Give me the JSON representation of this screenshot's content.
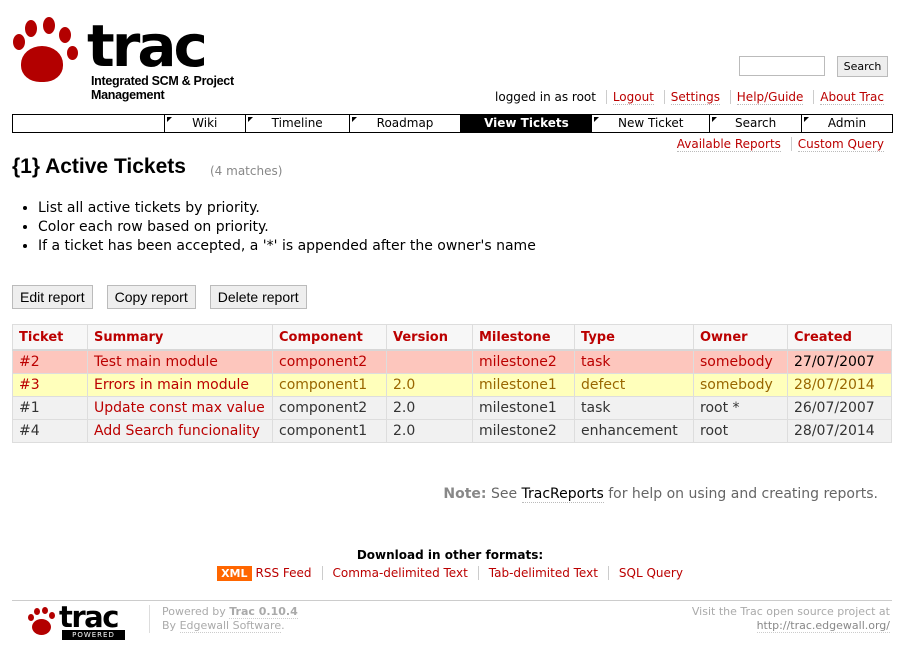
{
  "header": {
    "logo_word": "trac",
    "logo_tagline": "Integrated SCM & Project Management",
    "search_button": "Search"
  },
  "metanav": [
    "logged in as root",
    "Logout",
    "Settings",
    "Help/Guide",
    "About Trac"
  ],
  "mainnav": {
    "tabs": [
      "Wiki",
      "Timeline",
      "Roadmap",
      "View Tickets",
      "New Ticket",
      "Search",
      "Admin"
    ],
    "active": "View Tickets"
  },
  "ctxtnav": [
    "Available Reports",
    "Custom Query"
  ],
  "report": {
    "title": "{1} Active Tickets",
    "match_count": "(4 matches)",
    "description": [
      "List all active tickets by priority.",
      "Color each row based on priority.",
      "If a ticket has been accepted, a '*' is appended after the owner's name"
    ],
    "buttons": [
      "Edit report",
      "Copy report",
      "Delete report"
    ]
  },
  "table": {
    "columns": [
      "Ticket",
      "Summary",
      "Component",
      "Version",
      "Milestone",
      "Type",
      "Owner",
      "Created"
    ],
    "rows": [
      {
        "ticket": "#2",
        "summary": "Test main module",
        "component": "component2",
        "version": "",
        "milestone": "milestone2",
        "type": "task",
        "owner": "somebody",
        "created": "27/07/2007"
      },
      {
        "ticket": "#3",
        "summary": "Errors in main module",
        "component": "component1",
        "version": "2.0",
        "milestone": "milestone1",
        "type": "defect",
        "owner": "somebody",
        "created": "28/07/2014"
      },
      {
        "ticket": "#1",
        "summary": "Update const max value",
        "component": "component2",
        "version": "2.0",
        "milestone": "milestone1",
        "type": "task",
        "owner": "root *",
        "created": "26/07/2007"
      },
      {
        "ticket": "#4",
        "summary": "Add Search funcionality",
        "component": "component1",
        "version": "2.0",
        "milestone": "milestone2",
        "type": "enhancement",
        "owner": "root",
        "created": "28/07/2014"
      }
    ]
  },
  "note": {
    "label": "Note:",
    "prefix": "See",
    "link": "TracReports",
    "suffix": "for help on using and creating reports."
  },
  "altlinks": {
    "title": "Download in other formats:",
    "xml_badge": "XML",
    "formats": [
      "RSS Feed",
      "Comma-delimited Text",
      "Tab-delimited Text",
      "SQL Query"
    ]
  },
  "footer": {
    "logo_word": "trac",
    "powered_badge": "POWERED",
    "powered_by": "Powered by",
    "version": "Trac 0.10.4",
    "by": "By",
    "company": "Edgewall Software",
    "visit_text": "Visit the Trac open source project at",
    "url": "http://trac.edgewall.org/"
  },
  "colors": {
    "link": "#bb0000",
    "priority_high_row": "#fdc6bd",
    "priority_normal_row": "#ffffbb",
    "priority_low_row": "#f1f1f1",
    "xml_badge": "#ff6600"
  }
}
